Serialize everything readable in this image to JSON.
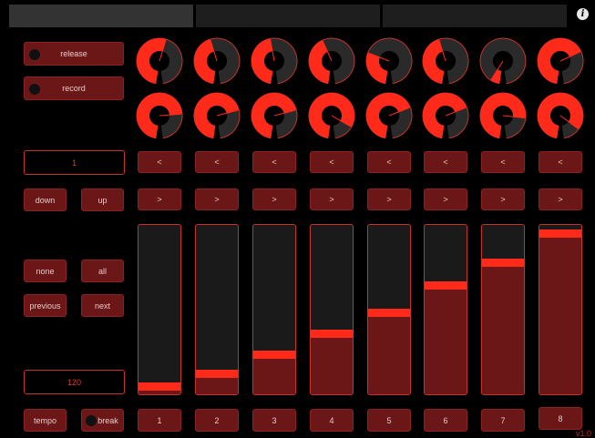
{
  "tabs": [
    "",
    "",
    ""
  ],
  "info_icon": "info-icon",
  "left": {
    "release_label": "release",
    "record_label": "record",
    "value1": "1",
    "down_label": "down",
    "up_label": "up",
    "none_label": "none",
    "all_label": "all",
    "previous_label": "previous",
    "next_label": "next",
    "tempo_value": "120",
    "tempo_label": "tempo",
    "break_label": "break"
  },
  "channels": [
    {
      "label": "1",
      "prev": "<",
      "next": ">",
      "fader": 0.02,
      "knob_top": 0.55,
      "knob_bottom": 0.75
    },
    {
      "label": "2",
      "prev": "<",
      "next": ">",
      "fader": 0.1,
      "knob_top": 0.45,
      "knob_bottom": 0.72
    },
    {
      "label": "3",
      "prev": "<",
      "next": ">",
      "fader": 0.22,
      "knob_top": 0.47,
      "knob_bottom": 0.72
    },
    {
      "label": "4",
      "prev": "<",
      "next": ">",
      "fader": 0.35,
      "knob_top": 0.43,
      "knob_bottom": 0.85
    },
    {
      "label": "5",
      "prev": "<",
      "next": ">",
      "fader": 0.48,
      "knob_top": 0.3,
      "knob_bottom": 0.7
    },
    {
      "label": "6",
      "prev": "<",
      "next": ">",
      "fader": 0.65,
      "knob_top": 0.45,
      "knob_bottom": 0.7
    },
    {
      "label": "7",
      "prev": "<",
      "next": ">",
      "fader": 0.79,
      "knob_top": 0.07,
      "knob_bottom": 0.78
    },
    {
      "label": "8",
      "prev": "<",
      "next": ">",
      "fader": 0.97,
      "knob_top": 0.69,
      "knob_bottom": 0.87
    }
  ],
  "version": "v1.0",
  "colors": {
    "accent": "#ff2a1a",
    "button": "#6b1717",
    "border": "#c4342a",
    "background": "#000000"
  }
}
